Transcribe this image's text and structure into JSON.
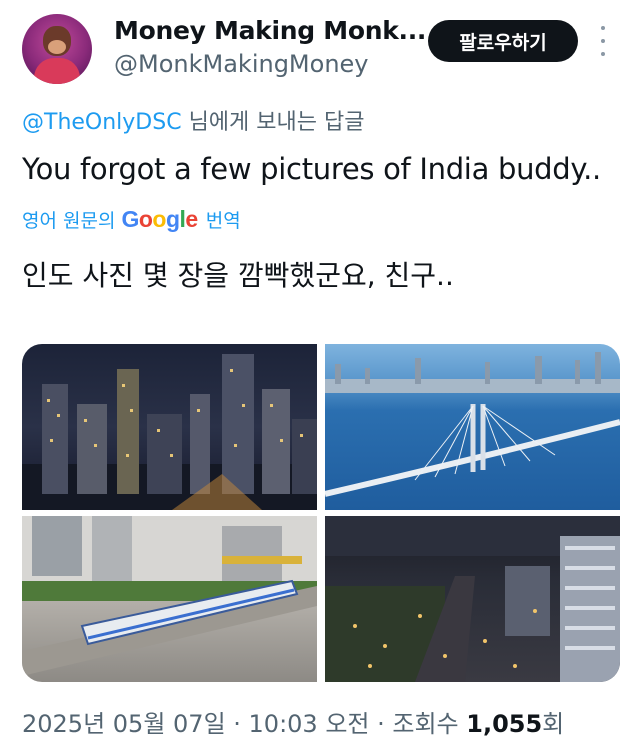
{
  "author": {
    "display_name": "Money Making Monk...",
    "handle": "@MonkMakingMoney",
    "follow_label": "팔로우하기"
  },
  "reply": {
    "mention": "@TheOnlyDSC",
    "suffix": " 님에게 보내는 답글"
  },
  "tweet": {
    "text": "You forgot a few pictures of India buddy.."
  },
  "translation": {
    "prefix": "영어 원문의",
    "google_letters": [
      "G",
      "o",
      "o",
      "g",
      "l",
      "e"
    ],
    "suffix": "번역",
    "text": "인도 사진 몇 장을 깜빡했군요, 친구.."
  },
  "media": {
    "photos": [
      "city-night-skyline",
      "sea-link-bridge",
      "metro-train",
      "city-night-aerial"
    ]
  },
  "meta": {
    "datetime": "2025년 05월 07일 · 10:03 오전 · 조회수 ",
    "views": "1,055",
    "views_suffix": "회"
  }
}
